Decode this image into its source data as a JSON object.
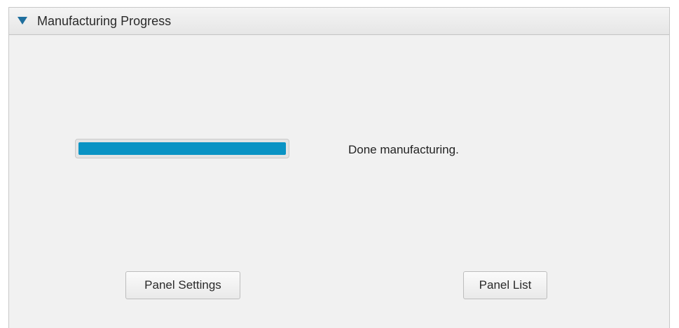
{
  "window": {
    "title": "Manufacturing Progress"
  },
  "progress": {
    "value": 1.0,
    "fill_color": "#0a93c4",
    "status_text": "Done manufacturing."
  },
  "buttons": {
    "panel_settings": "Panel Settings",
    "panel_list": "Panel List"
  },
  "icons": {
    "collapse": "triangle-down-icon"
  }
}
